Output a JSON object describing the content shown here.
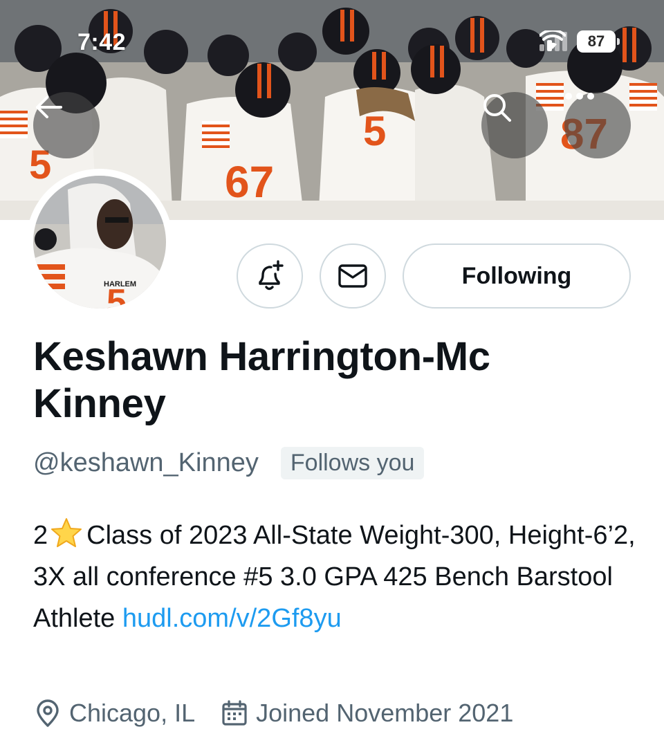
{
  "status_bar": {
    "time": "7:42",
    "battery": "87"
  },
  "header": {
    "back_icon": "arrow-left-icon",
    "search_icon": "search-icon",
    "more_icon": "more-horizontal-icon"
  },
  "actions": {
    "notify_icon": "bell-plus-icon",
    "message_icon": "mail-icon",
    "following_label": "Following"
  },
  "profile": {
    "display_name": "Keshawn Harrington-Mc Kinney",
    "handle": "@keshawn_Kinney",
    "follows_you": "Follows you",
    "bio_before_star": "2",
    "bio_main": "Class of 2023 All-State Weight-300, Height-6’2, 3X all conference #5 3.0 GPA 425 Bench Barstool Athlete",
    "bio_link": "hudl.com/v/2Gf8yu",
    "location": "Chicago, IL",
    "joined": "Joined November 2021"
  },
  "colors": {
    "link": "#1d9bf0",
    "secondary_text": "#536471",
    "border": "#cfd9de",
    "team_orange": "#e2541b"
  }
}
